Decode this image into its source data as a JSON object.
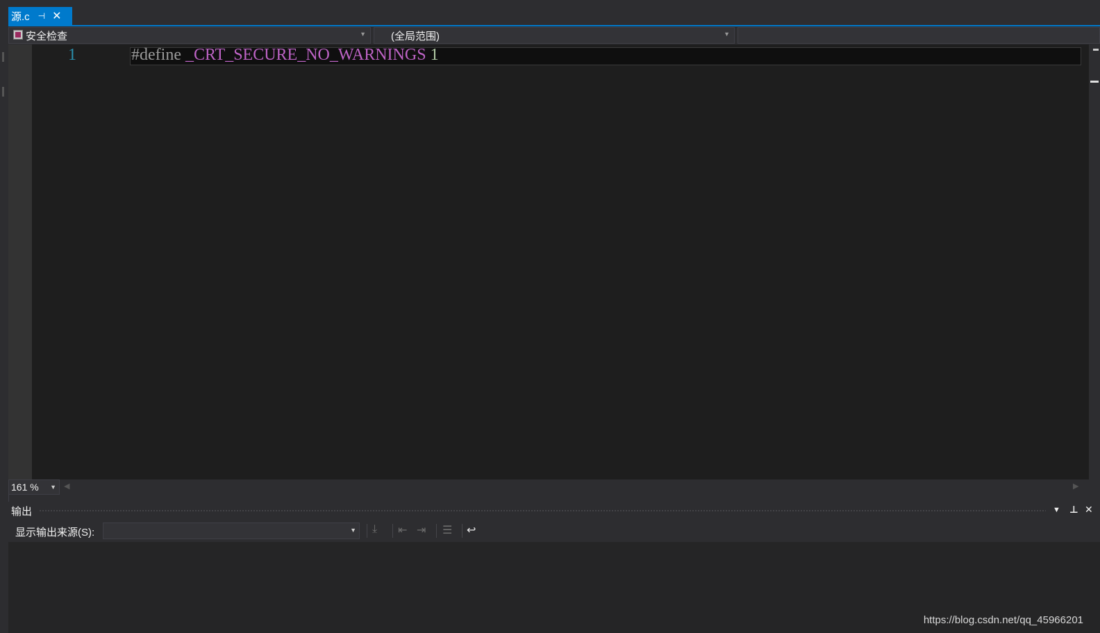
{
  "tab": {
    "filename": "源.c",
    "pin_glyph": "⊣",
    "close_glyph": "✕"
  },
  "navbar": {
    "project": "安全检查",
    "scope": "(全局范围)",
    "arrow_glyph": "▼"
  },
  "editor": {
    "line_numbers": [
      "1"
    ],
    "code_line": {
      "directive": "#define ",
      "macro": "_CRT_SECURE_NO_WARNINGS",
      "value": " 1"
    }
  },
  "zoom": {
    "level": "161 %"
  },
  "output": {
    "title": "输出",
    "source_label": "显示输出来源(S):",
    "source_value": "",
    "header_buttons": {
      "menu_glyph": "▼",
      "pin_glyph": "📌",
      "close_glyph": "✕"
    },
    "toolbar_icons": [
      "go-to-line-icon",
      "previous-message-icon",
      "next-message-icon",
      "clear-all-icon",
      "word-wrap-icon"
    ]
  },
  "watermark": "https://blog.csdn.net/qq_45966201",
  "colors": {
    "accent": "#007acc",
    "editor_bg": "#1e1e1e",
    "line_number": "#2b91af",
    "macro": "#bd63c5",
    "number": "#b5cea8",
    "directive": "#9b9b9b"
  }
}
